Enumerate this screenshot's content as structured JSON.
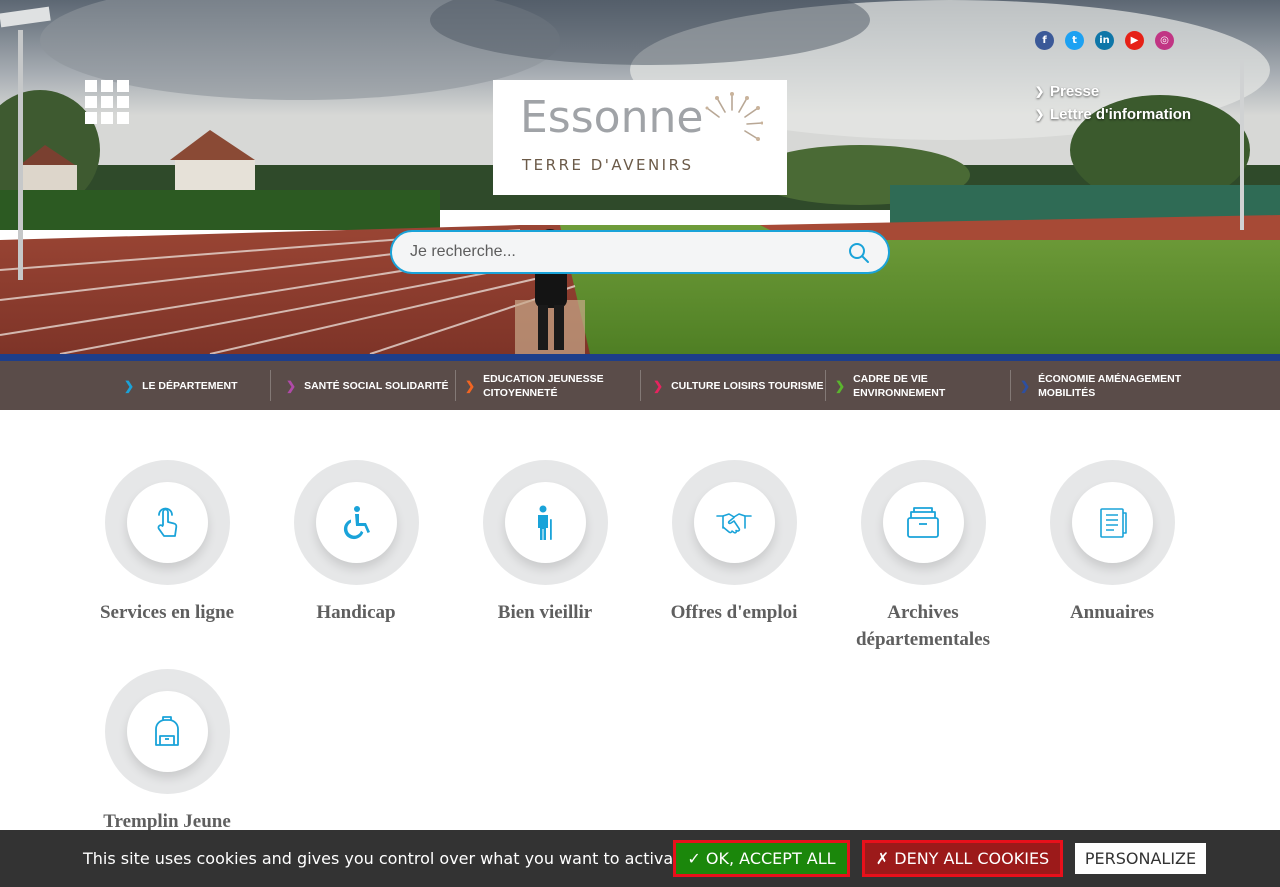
{
  "header": {
    "logo": {
      "word": "Essonne",
      "tagline": "TERRE D'AVENIRS"
    },
    "social_icons": [
      {
        "name": "facebook-icon",
        "glyph": "f",
        "color": "#3b5998"
      },
      {
        "name": "twitter-icon",
        "glyph": "t",
        "color": "#1da1f2"
      },
      {
        "name": "linkedin-icon",
        "glyph": "in",
        "color": "#0e76a8"
      },
      {
        "name": "youtube-icon",
        "glyph": "▶",
        "color": "#e62117"
      },
      {
        "name": "instagram-icon",
        "glyph": "◎",
        "color": "#c13584"
      }
    ],
    "top_links": [
      "Presse",
      "Lettre d'information"
    ]
  },
  "search": {
    "placeholder": "Je recherche..."
  },
  "nav": {
    "items": [
      {
        "label": "LE DÉPARTEMENT",
        "chev_color": "#1aa3d9"
      },
      {
        "label": "SANTÉ SOCIAL SOLIDARITÉ",
        "chev_color": "#b04aa8"
      },
      {
        "label": "EDUCATION JEUNESSE CITOYENNETÉ",
        "chev_color": "#f26522"
      },
      {
        "label": "CULTURE LOISIRS TOURISME",
        "chev_color": "#e6245f"
      },
      {
        "label": "CADRE DE VIE ENVIRONNEMENT",
        "chev_color": "#5ab52e"
      },
      {
        "label": "ÉCONOMIE AMÉNAGEMENT MOBILITÉS",
        "chev_color": "#2d4fa0"
      }
    ]
  },
  "quick_access": {
    "items": [
      {
        "label": "Services en ligne",
        "icon": "touch-hand-icon"
      },
      {
        "label": "Handicap",
        "icon": "wheelchair-icon"
      },
      {
        "label": "Bien vieillir",
        "icon": "elderly-person-icon"
      },
      {
        "label": "Offres d'emploi",
        "icon": "handshake-icon"
      },
      {
        "label": "Archives départementales",
        "icon": "archive-box-icon"
      },
      {
        "label": "Annuaires",
        "icon": "directory-book-icon"
      },
      {
        "label": "Tremplin Jeune",
        "icon": "backpack-icon"
      }
    ]
  },
  "cookie_bar": {
    "text": "This site uses cookies and gives you control over what you want to activate",
    "accept_label": "✓ OK, ACCEPT ALL",
    "deny_label": "✗ DENY ALL COOKIES",
    "personalize_label": "PERSONALIZE"
  },
  "colors": {
    "accent": "#1aa3d9",
    "nav_top_line": "#1d3e8a"
  }
}
